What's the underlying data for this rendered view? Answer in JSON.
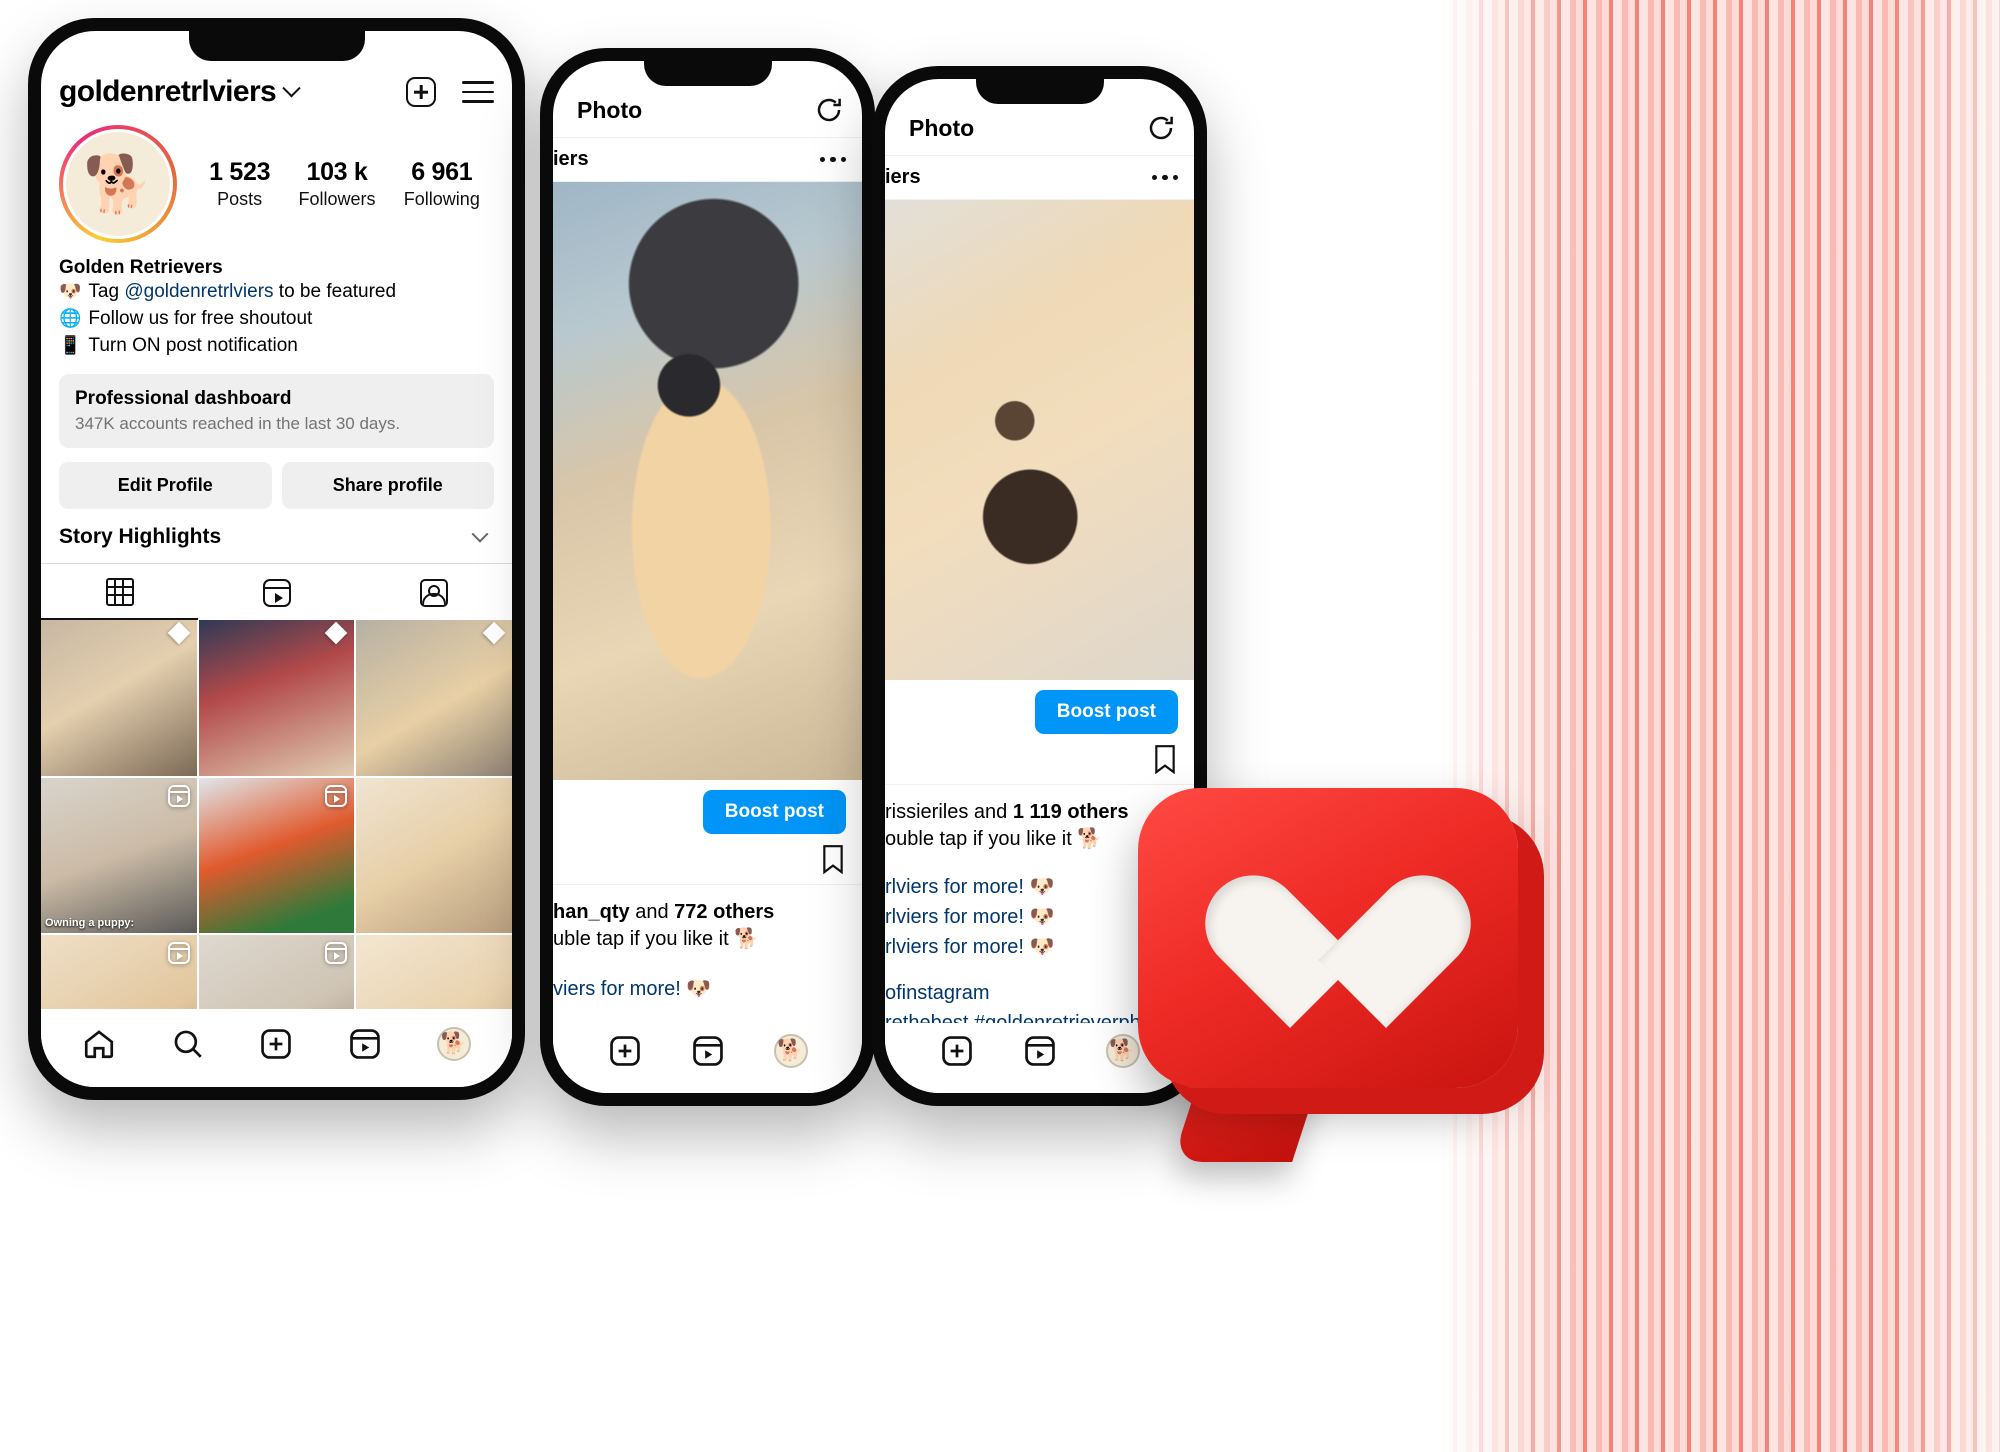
{
  "profile": {
    "username": "goldenretrlviers",
    "stats": [
      {
        "num": "1 523",
        "label": "Posts"
      },
      {
        "num": "103 k",
        "label": "Followers"
      },
      {
        "num": "6 961",
        "label": "Following"
      }
    ],
    "display_name": "Golden Retrievers",
    "bio_lines": [
      {
        "emoji": "🐶",
        "text_before": "Tag ",
        "link": "@goldenretrlviers",
        "text_after": " to be featured"
      },
      {
        "emoji": "🌐",
        "text_before": "Follow us for free shoutout",
        "link": "",
        "text_after": ""
      },
      {
        "emoji": "📱",
        "text_before": "Turn ON post notification",
        "link": "",
        "text_after": ""
      }
    ],
    "dashboard": {
      "title": "Professional dashboard",
      "subtitle": "347K accounts reached in the last 30 days."
    },
    "buttons": {
      "edit": "Edit Profile",
      "share": "Share profile"
    },
    "highlights_label": "Story Highlights",
    "tabs": [
      {
        "name": "grid",
        "active": true
      },
      {
        "name": "reels",
        "active": false
      },
      {
        "name": "tagged",
        "active": false
      }
    ],
    "grid_overlay_caption": "Owning a puppy:",
    "bottom_nav": [
      "home",
      "search",
      "create",
      "reels",
      "profile-avatar"
    ]
  },
  "post_mid": {
    "header_title": "Photo",
    "refresh_icon": "refresh-icon",
    "username_fragment": "iers",
    "boost_label": "Boost post",
    "likes_text_prefix": "han_qty",
    "likes_text_join": " and ",
    "likes_count": "772 others",
    "caption_line_1": "uble tap if you like it 🐕",
    "caption_line_2": "viers for more! 🐶",
    "bottom_nav": [
      "create",
      "reels",
      "profile-avatar"
    ]
  },
  "post_right": {
    "header_title": "Photo",
    "refresh_icon": "refresh-icon",
    "username_fragment": "iers",
    "boost_label": "Boost post",
    "likes_text_prefix": "rissieriles",
    "likes_text_join": " and ",
    "likes_count": "1 119 others",
    "caption_line_1": "ouble tap if you like it 🐕",
    "caption_line_2": "rlviers for more! 🐶",
    "caption_line_3": "rlviers for more! 🐶",
    "caption_line_4": "rlviers for more! 🐶",
    "caption_line_5": "ofinstagram",
    "caption_line_6": "rethebest #goldenretrieverph",
    "bottom_nav": [
      "create",
      "reels",
      "profile-avatar"
    ]
  },
  "colors": {
    "accent_blue": "#0095f6",
    "link_blue": "#00376b",
    "grey_button": "#efefef",
    "muted_text": "#737373",
    "like_red": "#ef2b26"
  }
}
